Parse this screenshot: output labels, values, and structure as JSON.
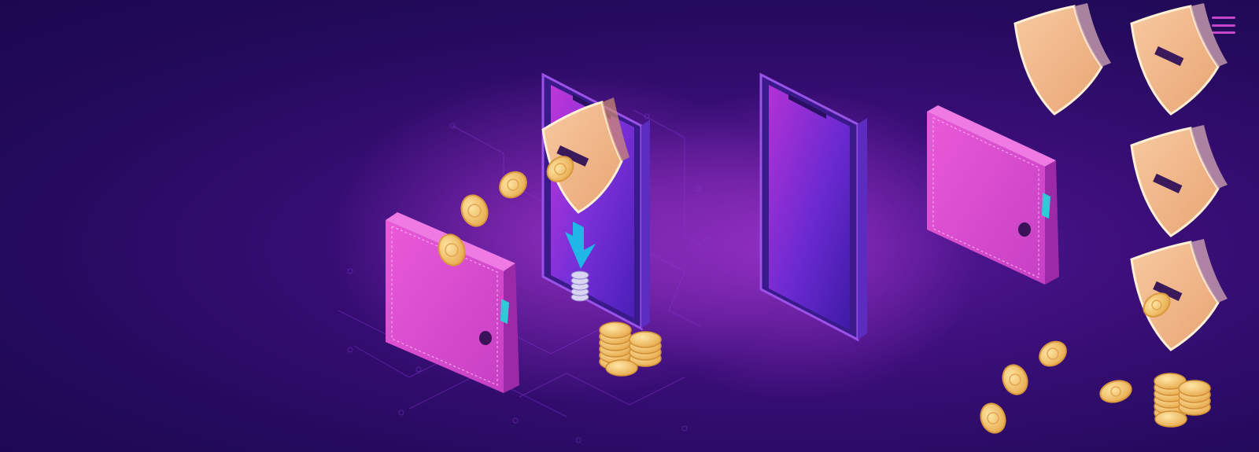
{
  "page": {
    "background": "#2a0c66",
    "accent": "#c447c9"
  },
  "header": {
    "menu_icon": "hamburger-menu-icon"
  },
  "illustration": {
    "items": [
      {
        "name": "wallet-open-left",
        "icon": "wallet-icon",
        "color": "#e04fd0"
      },
      {
        "name": "coins-flying",
        "icon": "coin-icon",
        "color": "#f7c66a"
      },
      {
        "name": "phone-with-shield",
        "icon": "smartphone-icon",
        "color": "#6a2ad0"
      },
      {
        "name": "download-arrow",
        "icon": "arrow-down-icon",
        "color": "#1fb8e6"
      },
      {
        "name": "coin-stack-on-phone",
        "icon": "coin-stack-icon",
        "color": "#c9c4e8"
      },
      {
        "name": "coin-pile",
        "icon": "coin-pile-icon",
        "color": "#f7c66a"
      },
      {
        "name": "phone-blank",
        "icon": "smartphone-icon",
        "color": "#7a30d8"
      },
      {
        "name": "wallet-closed-right",
        "icon": "wallet-icon",
        "color": "#e04fd0"
      },
      {
        "name": "shield-plain",
        "icon": "shield-icon",
        "color": "#f2b78a"
      },
      {
        "name": "shield-with-slot",
        "icon": "shield-slot-icon",
        "color": "#f2b78a"
      }
    ]
  }
}
